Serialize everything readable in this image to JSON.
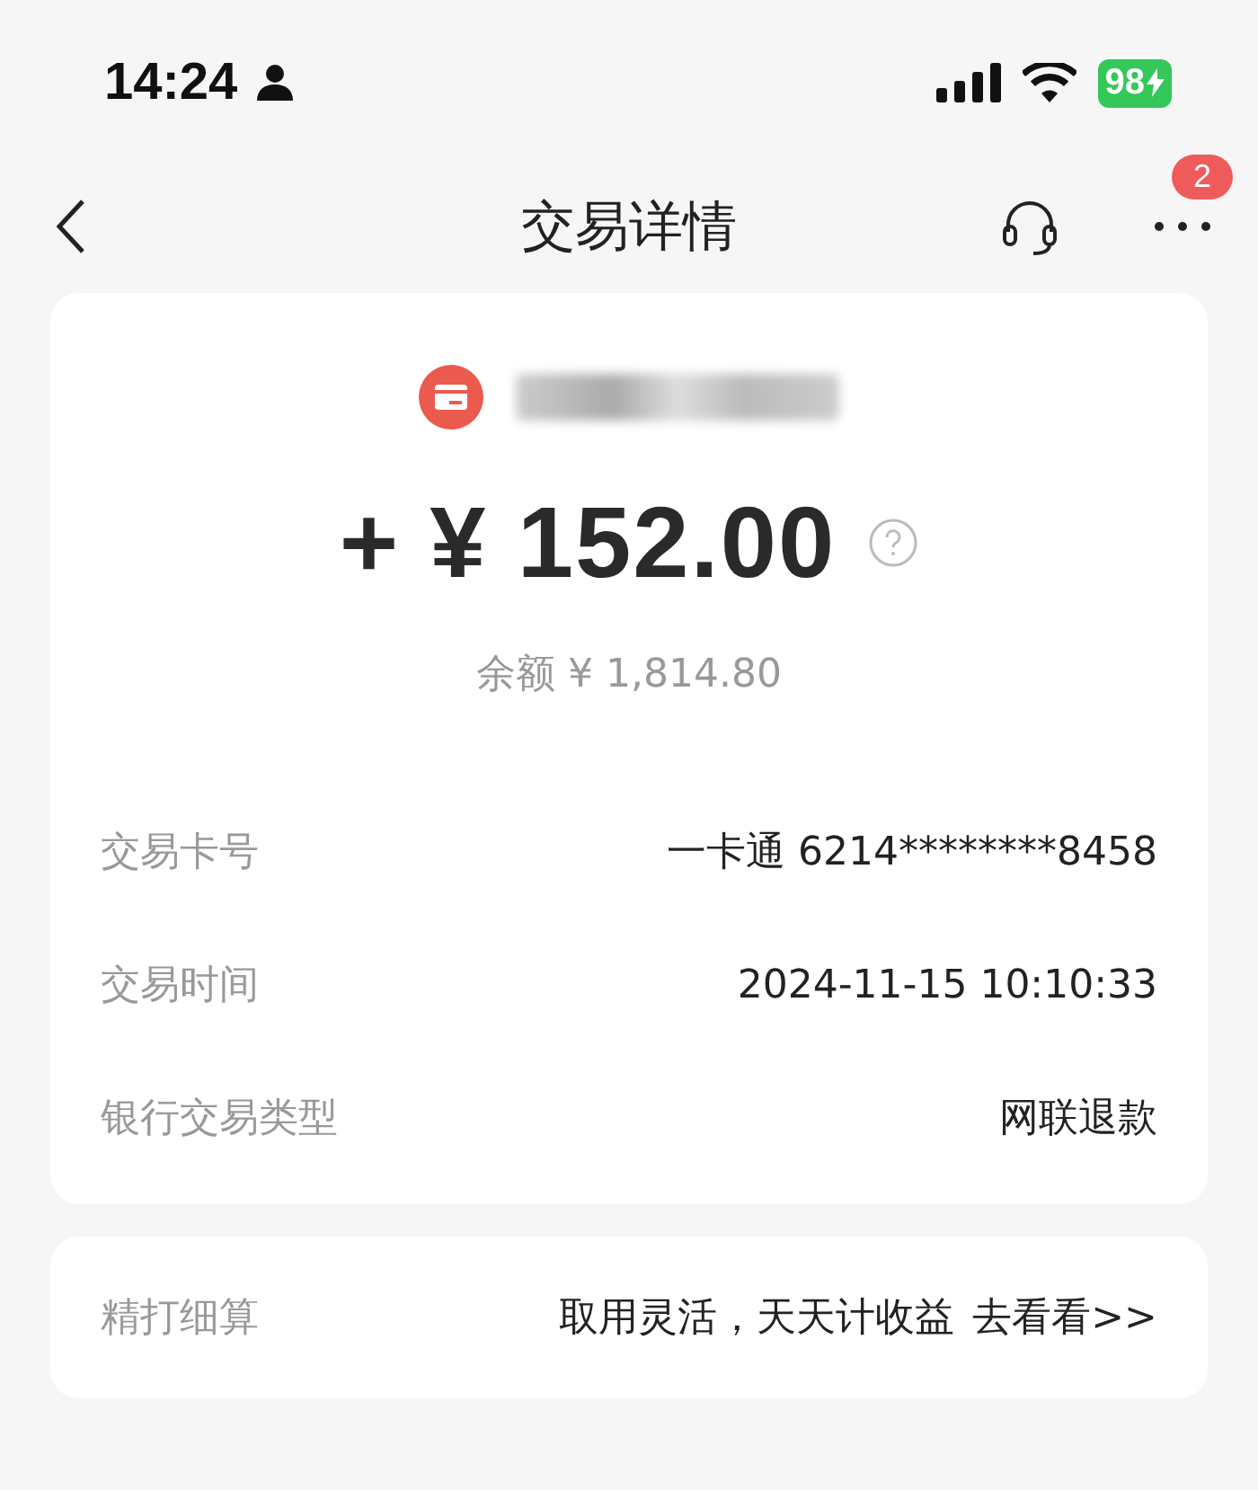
{
  "status_bar": {
    "time": "14:24",
    "battery": "98"
  },
  "nav": {
    "title": "交易详情",
    "badge": "2"
  },
  "summary": {
    "amount": "+ ¥ 152.00",
    "balance": "余额 ¥ 1,814.80"
  },
  "details": [
    {
      "label": "交易卡号",
      "value": "一卡通 6214********8458"
    },
    {
      "label": "交易时间",
      "value": "2024-11-15 10:10:33"
    },
    {
      "label": "银行交易类型",
      "value": "网联退款"
    }
  ],
  "promo": {
    "label": "精打细算",
    "text": "取用灵活，天天计收益",
    "link": "去看看>>"
  }
}
